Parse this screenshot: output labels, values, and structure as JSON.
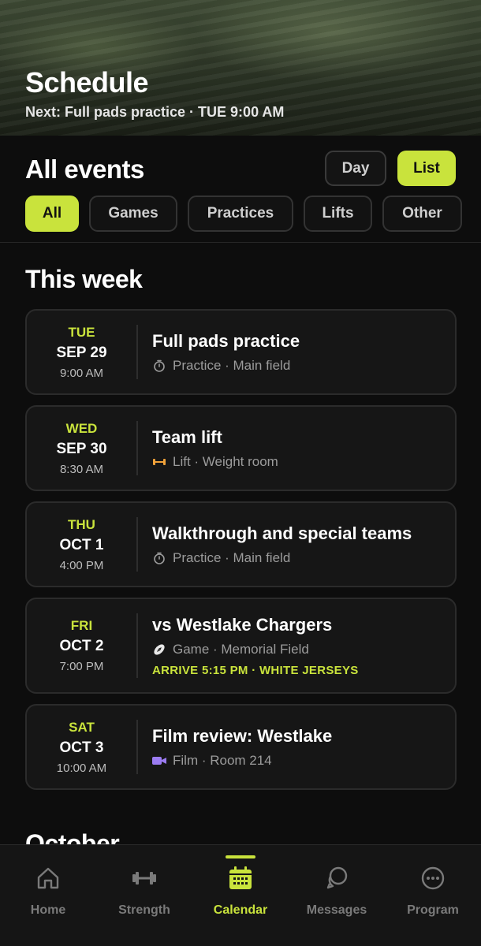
{
  "header": {
    "title": "Schedule",
    "subtitle": "Next: Full pads practice · TUE 9:00 AM"
  },
  "events_section": {
    "title": "All events",
    "view_toggle": {
      "day_label": "Day",
      "list_label": "List",
      "selected": "List"
    },
    "filters": [
      {
        "label": "All",
        "active": true
      },
      {
        "label": "Games",
        "active": false
      },
      {
        "label": "Practices",
        "active": false
      },
      {
        "label": "Lifts",
        "active": false
      },
      {
        "label": "Other",
        "active": false
      }
    ]
  },
  "this_week": {
    "title": "This week",
    "events": [
      {
        "dow": "TUE",
        "date": "SEP 29",
        "time": "9:00 AM",
        "title": "Full pads practice",
        "icon": "stopwatch-icon",
        "meta": "Practice · Main field",
        "note": ""
      },
      {
        "dow": "WED",
        "date": "SEP 30",
        "time": "8:30 AM",
        "title": "Team lift",
        "icon": "dumbbell-icon",
        "meta": "Lift · Weight room",
        "note": ""
      },
      {
        "dow": "THU",
        "date": "OCT 1",
        "time": "4:00 PM",
        "title": "Walkthrough and special teams",
        "icon": "stopwatch-icon",
        "meta": "Practice · Main field",
        "note": ""
      },
      {
        "dow": "FRI",
        "date": "OCT 2",
        "time": "7:00 PM",
        "title": "vs Westlake Chargers",
        "icon": "football-icon",
        "meta": "Game · Memorial Field",
        "note": "ARRIVE 5:15 PM · WHITE JERSEYS"
      },
      {
        "dow": "SAT",
        "date": "OCT 3",
        "time": "10:00 AM",
        "title": "Film review: Westlake",
        "icon": "video-camera-icon",
        "meta": "Film · Room 214",
        "note": ""
      }
    ]
  },
  "next_section": {
    "title": "October"
  },
  "tabbar": {
    "active": "Calendar",
    "tabs": [
      {
        "label": "Home",
        "icon": "home-icon"
      },
      {
        "label": "Strength",
        "icon": "dumbbell-icon"
      },
      {
        "label": "Calendar",
        "icon": "calendar-icon"
      },
      {
        "label": "Messages",
        "icon": "chat-bubbles-icon"
      },
      {
        "label": "Program",
        "icon": "more-circle-icon"
      }
    ]
  },
  "colors": {
    "accent": "#c9e33c",
    "background": "#0d0d0d",
    "card": "#161616",
    "lift_orange": "#f0a23a",
    "film_purple": "#9b7cf2"
  }
}
